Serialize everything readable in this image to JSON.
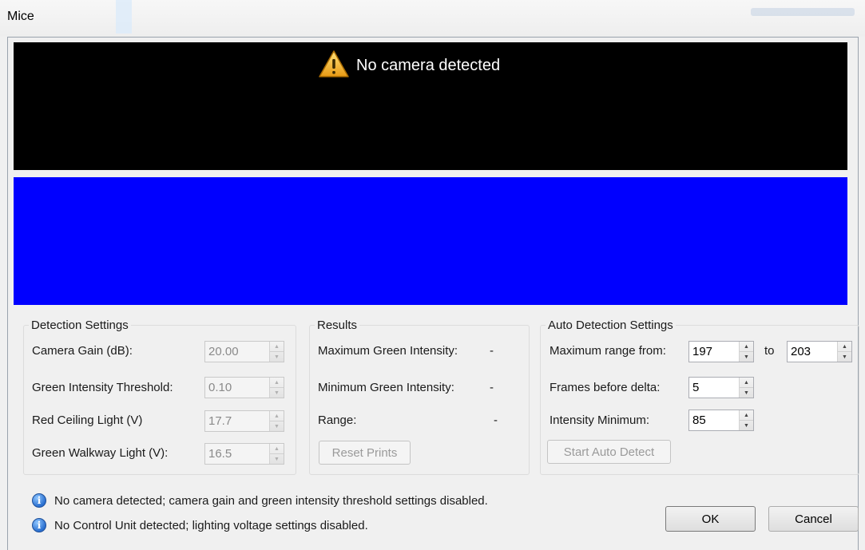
{
  "window": {
    "title": "Mice"
  },
  "camera": {
    "message": "No camera detected"
  },
  "detection": {
    "legend": "Detection Settings",
    "camera_gain": {
      "label": "Camera Gain (dB):",
      "value": "20.00"
    },
    "green_threshold": {
      "label": "Green Intensity Threshold:",
      "value": "0.10"
    },
    "red_ceiling": {
      "label": "Red Ceiling Light (V)",
      "value": "17.7"
    },
    "green_walkway": {
      "label": "Green Walkway Light (V):",
      "value": "16.5"
    }
  },
  "results": {
    "legend": "Results",
    "max_green": {
      "label": "Maximum Green Intensity:",
      "value": "-"
    },
    "min_green": {
      "label": "Minimum Green Intensity:",
      "value": "-"
    },
    "range": {
      "label": "Range:",
      "value": "-"
    },
    "reset_label": "Reset Prints"
  },
  "auto": {
    "legend": "Auto Detection Settings",
    "max_range_label": "Maximum range from:",
    "range_from": "197",
    "to_label": "to",
    "range_to": "203",
    "frames_label": "Frames before delta:",
    "frames_value": "5",
    "intensity_label": "Intensity Minimum:",
    "intensity_value": "85",
    "start_label": "Start Auto Detect"
  },
  "messages": [
    "No camera detected; camera gain and green intensity threshold settings disabled.",
    "No Control Unit detected; lighting voltage settings disabled."
  ],
  "buttons": {
    "ok": "OK",
    "cancel": "Cancel"
  }
}
